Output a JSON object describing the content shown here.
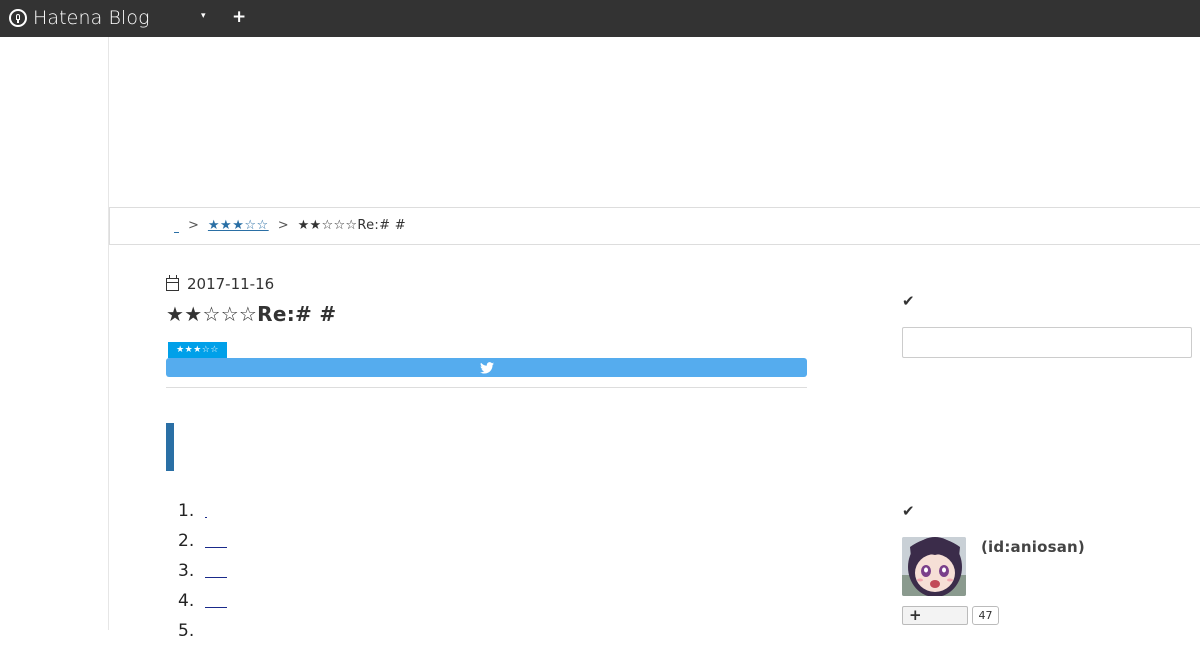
{
  "topbar": {
    "brand": "Hatena Blog",
    "menu_caret": "▾",
    "add_icon": "plus-icon",
    "add_symbol": "+"
  },
  "breadcrumb": {
    "category_link": "★★★☆☆",
    "separator": ">",
    "current": "★★☆☆☆Re:# #"
  },
  "entry": {
    "date": "2017-11-16",
    "title": "★★☆☆☆Re:# #",
    "category_tag": "★★★☆☆",
    "share_icon": "twitter-icon",
    "toc": [
      {
        "num": "1."
      },
      {
        "num": "2."
      },
      {
        "num": "3."
      },
      {
        "num": "4."
      },
      {
        "num": "5."
      }
    ]
  },
  "sidebar": {
    "check_symbol": "✔",
    "profile_id": "(id:aniosan)",
    "follow_symbol": "+",
    "follow_count": "47"
  },
  "colors": {
    "topbar": "#333333",
    "link": "#2a6fa5",
    "category_tag": "#00a0e9",
    "tweet_button": "#55acee",
    "section_bar": "#2a6fa5"
  }
}
